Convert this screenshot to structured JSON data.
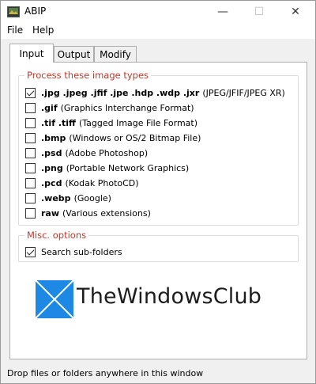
{
  "window": {
    "title": "ABIP",
    "min_glyph": "—",
    "max_glyph": "☐",
    "close_glyph": "✕"
  },
  "menu": {
    "file": "File",
    "help": "Help"
  },
  "tabs": [
    {
      "label": "Input",
      "selected": true
    },
    {
      "label": "Output",
      "selected": false
    },
    {
      "label": "Modify",
      "selected": false
    }
  ],
  "image_types": {
    "legend": "Process these image types",
    "items": [
      {
        "ext": ".jpg .jpeg .jfif .jpe .hdp .wdp .jxr",
        "desc": "(JPEG/JFIF/JPEG XR)",
        "checked": true
      },
      {
        "ext": ".gif",
        "desc": "(Graphics Interchange Format)",
        "checked": false
      },
      {
        "ext": ".tif .tiff",
        "desc": "(Tagged Image File Format)",
        "checked": false
      },
      {
        "ext": ".bmp",
        "desc": "(Windows or OS/2 Bitmap File)",
        "checked": false
      },
      {
        "ext": ".psd",
        "desc": "(Adobe Photoshop)",
        "checked": false
      },
      {
        "ext": ".png",
        "desc": "(Portable Network Graphics)",
        "checked": false
      },
      {
        "ext": ".pcd",
        "desc": "(Kodak PhotoCD)",
        "checked": false
      },
      {
        "ext": ".webp",
        "desc": "(Google)",
        "checked": false
      },
      {
        "ext": "raw",
        "desc": "(Various extensions)",
        "checked": false
      }
    ]
  },
  "misc": {
    "legend": "Misc. options",
    "subfolders_label": "Search sub-folders",
    "subfolders_checked": true
  },
  "watermark": {
    "text": "TheWindowsClub"
  },
  "status": {
    "text": "Drop files or folders anywhere in this window"
  },
  "colors": {
    "legend_red": "#c0392b",
    "logo_blue": "#1e88e5"
  }
}
